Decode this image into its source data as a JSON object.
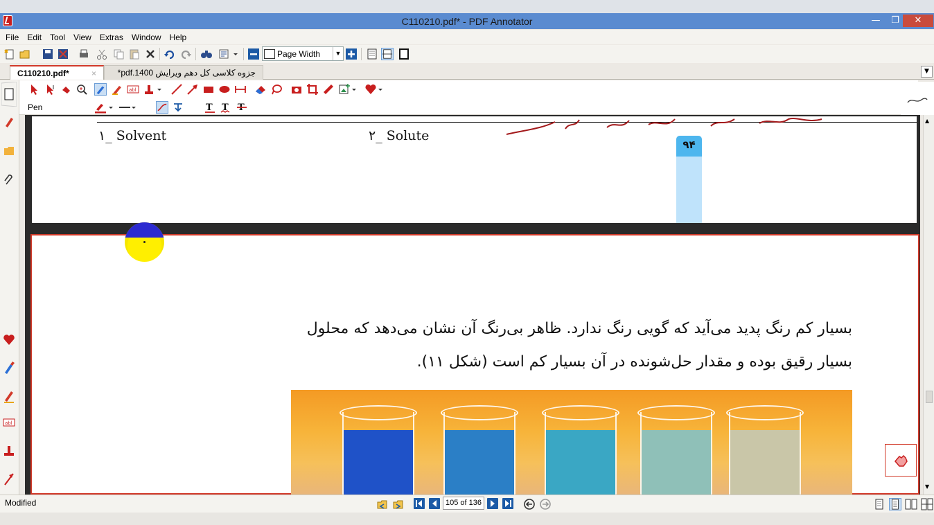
{
  "window": {
    "title": "C110210.pdf* - PDF Annotator",
    "min_icon": "minimize-icon",
    "max_icon": "maximize-icon",
    "close_icon": "close-icon",
    "min_glyph": "—",
    "max_glyph": "❐",
    "close_glyph": "✕"
  },
  "menu": {
    "items": [
      "File",
      "Edit",
      "Tool",
      "View",
      "Extras",
      "Window",
      "Help"
    ]
  },
  "toolbar": {
    "zoom_value": "Page Width"
  },
  "tabs": [
    {
      "label": "C110210.pdf*",
      "active": true,
      "close": "×"
    },
    {
      "label": "جزوه کلاسی کل دهم ویرایش 1400.pdf*",
      "active": false
    }
  ],
  "annot_toolbar": {
    "tool_label": "Pen"
  },
  "document": {
    "prev_page": {
      "label_1": "۱_ Solvent",
      "label_2": "۲_ Solute",
      "page_number": "۹۴"
    },
    "current_page": {
      "line_1": "بسیار کم رنگ پدید می‌آید که گویی رنگ ندارد. ظاهر بی‌رنگ آن نشان می‌دهد که محلول",
      "line_2": "بسیار رقیق بوده و مقدار حل‌شونده در آن بسیار کم است (شکل ۱۱)."
    },
    "beaker_colors": [
      "#1f52c8",
      "#2b7fc6",
      "#3aa7c4",
      "#8fc0b8",
      "#c9c6a8"
    ]
  },
  "status": {
    "text": "Modified",
    "page_indicator": "105 of 136"
  },
  "colors": {
    "accent": "#d23a2a",
    "titlebar": "#5a8bd0",
    "nav_blue": "#1c5aa6"
  }
}
